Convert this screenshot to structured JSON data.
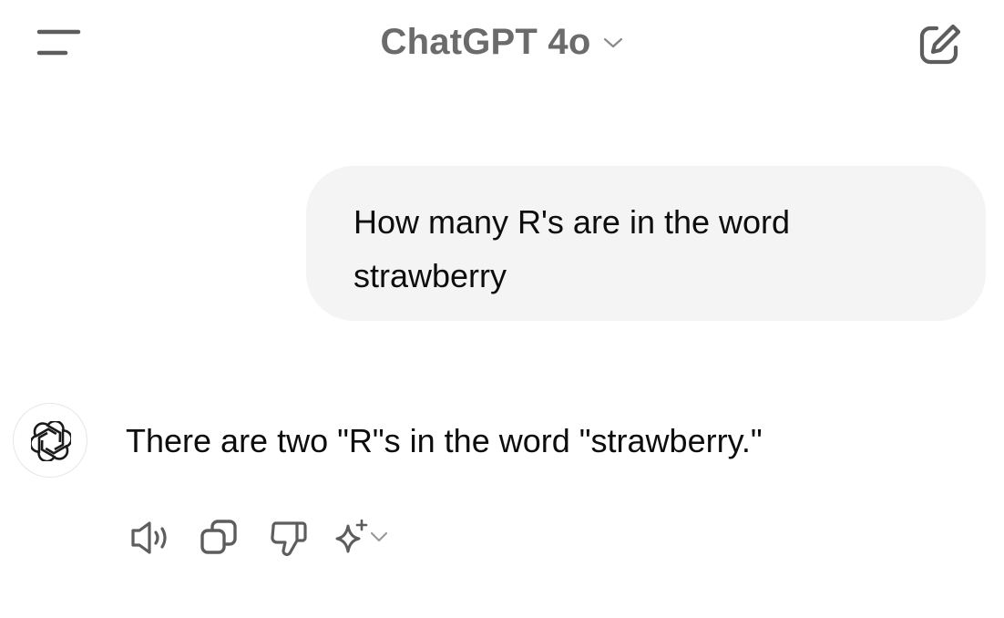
{
  "header": {
    "menu_icon": "hamburger-menu-icon",
    "title": "ChatGPT 4o",
    "title_chevron_icon": "chevron-down-icon",
    "new_chat_icon": "compose-edit-icon"
  },
  "conversation": {
    "user_message": "How many R's are in the word strawberry",
    "assistant_avatar_icon": "openai-logo-icon",
    "assistant_message": "There are two \"R\"s in the word \"strawberry.\""
  },
  "actions": {
    "read_aloud_icon": "speaker-icon",
    "copy_icon": "copy-icon",
    "thumbs_down_icon": "thumbs-down-icon",
    "regenerate_icon": "sparkle-icon",
    "regenerate_chevron_icon": "chevron-down-icon"
  },
  "colors": {
    "title": "#6b6b6b",
    "bubble_bg": "#f4f4f4",
    "text": "#0d0d0d",
    "icon": "#5d5d5d"
  }
}
